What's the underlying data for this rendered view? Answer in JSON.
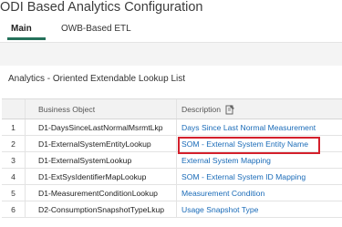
{
  "page": {
    "title": "ODI Based Analytics Configuration"
  },
  "tabs": [
    {
      "label": "Main"
    },
    {
      "label": "OWB-Based ETL"
    }
  ],
  "section": {
    "title": "Analytics - Oriented Extendable Lookup List"
  },
  "table": {
    "columns": [
      "",
      "Business Object",
      "Description"
    ],
    "rows": [
      {
        "num": "1",
        "business_object": "D1-DaysSinceLastNormalMsrmtLkp",
        "description": "Days Since Last Normal Measurement"
      },
      {
        "num": "2",
        "business_object": "D1-ExternalSystemEntityLookup",
        "description": "SOM - External System Entity Name"
      },
      {
        "num": "3",
        "business_object": "D1-ExternalSystemLookup",
        "description": "External System Mapping"
      },
      {
        "num": "4",
        "business_object": "D1-ExtSysIdentifierMapLookup",
        "description": "SOM - External System ID Mapping"
      },
      {
        "num": "5",
        "business_object": "D1-MeasurementConditionLookup",
        "description": "Measurement Condition"
      },
      {
        "num": "6",
        "business_object": "D2-ConsumptionSnapshotTypeLkup",
        "description": "Usage Snapshot Type"
      }
    ]
  },
  "colors": {
    "tab_accent": "#24715a",
    "highlight": "#d4202c",
    "link": "#1a6bb8"
  },
  "icons": {
    "description_header": "edit-document-icon"
  }
}
